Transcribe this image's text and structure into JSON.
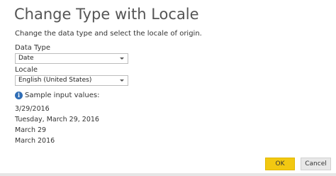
{
  "dialog": {
    "title": "Change Type with Locale",
    "subtitle": "Change the data type and select the locale of origin."
  },
  "data_type": {
    "label": "Data Type",
    "value": "Date"
  },
  "locale": {
    "label": "Locale",
    "value": "English (United States)"
  },
  "samples": {
    "heading": "Sample input values:",
    "icon_glyph": "i",
    "icon_name": "info-icon",
    "values": [
      "3/29/2016",
      "Tuesday, March 29, 2016",
      "March 29",
      "March 2016"
    ]
  },
  "buttons": {
    "ok_label": "OK",
    "cancel_label": "Cancel"
  },
  "colors": {
    "ok_button": "#f2c811",
    "info_icon": "#2f6db5",
    "title_text": "#555555"
  }
}
